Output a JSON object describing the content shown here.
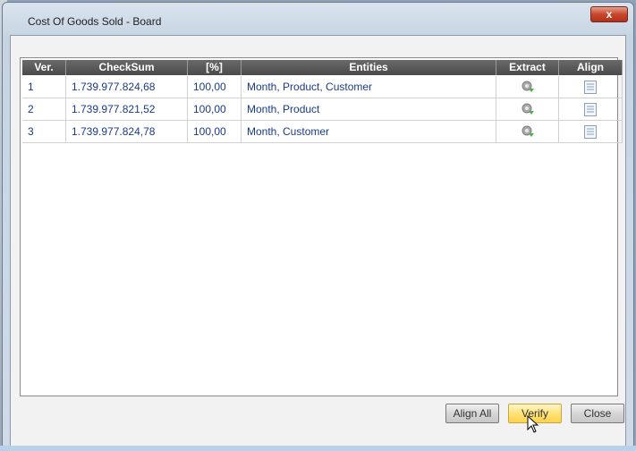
{
  "window": {
    "title": "Cost Of Goods Sold - Board",
    "close_label": "x"
  },
  "grid": {
    "columns": [
      "Ver.",
      "CheckSum",
      "[%]",
      "Entities",
      "Extract",
      "Align"
    ],
    "rows": [
      {
        "ver": "1",
        "checksum": "1.739.977.824,68",
        "percent": "100,00",
        "entities": "Month, Product, Customer"
      },
      {
        "ver": "2",
        "checksum": "1.739.977.821,52",
        "percent": "100,00",
        "entities": "Month, Product"
      },
      {
        "ver": "3",
        "checksum": "1.739.977.824,78",
        "percent": "100,00",
        "entities": "Month, Customer"
      }
    ]
  },
  "buttons": {
    "align_all": "Align All",
    "verify": "Verify",
    "close": "Close"
  },
  "icons": {
    "extract": "gear-arrow-icon",
    "align": "document-icon",
    "cursor": "pointer-cursor-icon"
  },
  "colors": {
    "header": "#555555",
    "cell_text": "#1a3a8a",
    "verify_hover": "#ffd34a"
  }
}
